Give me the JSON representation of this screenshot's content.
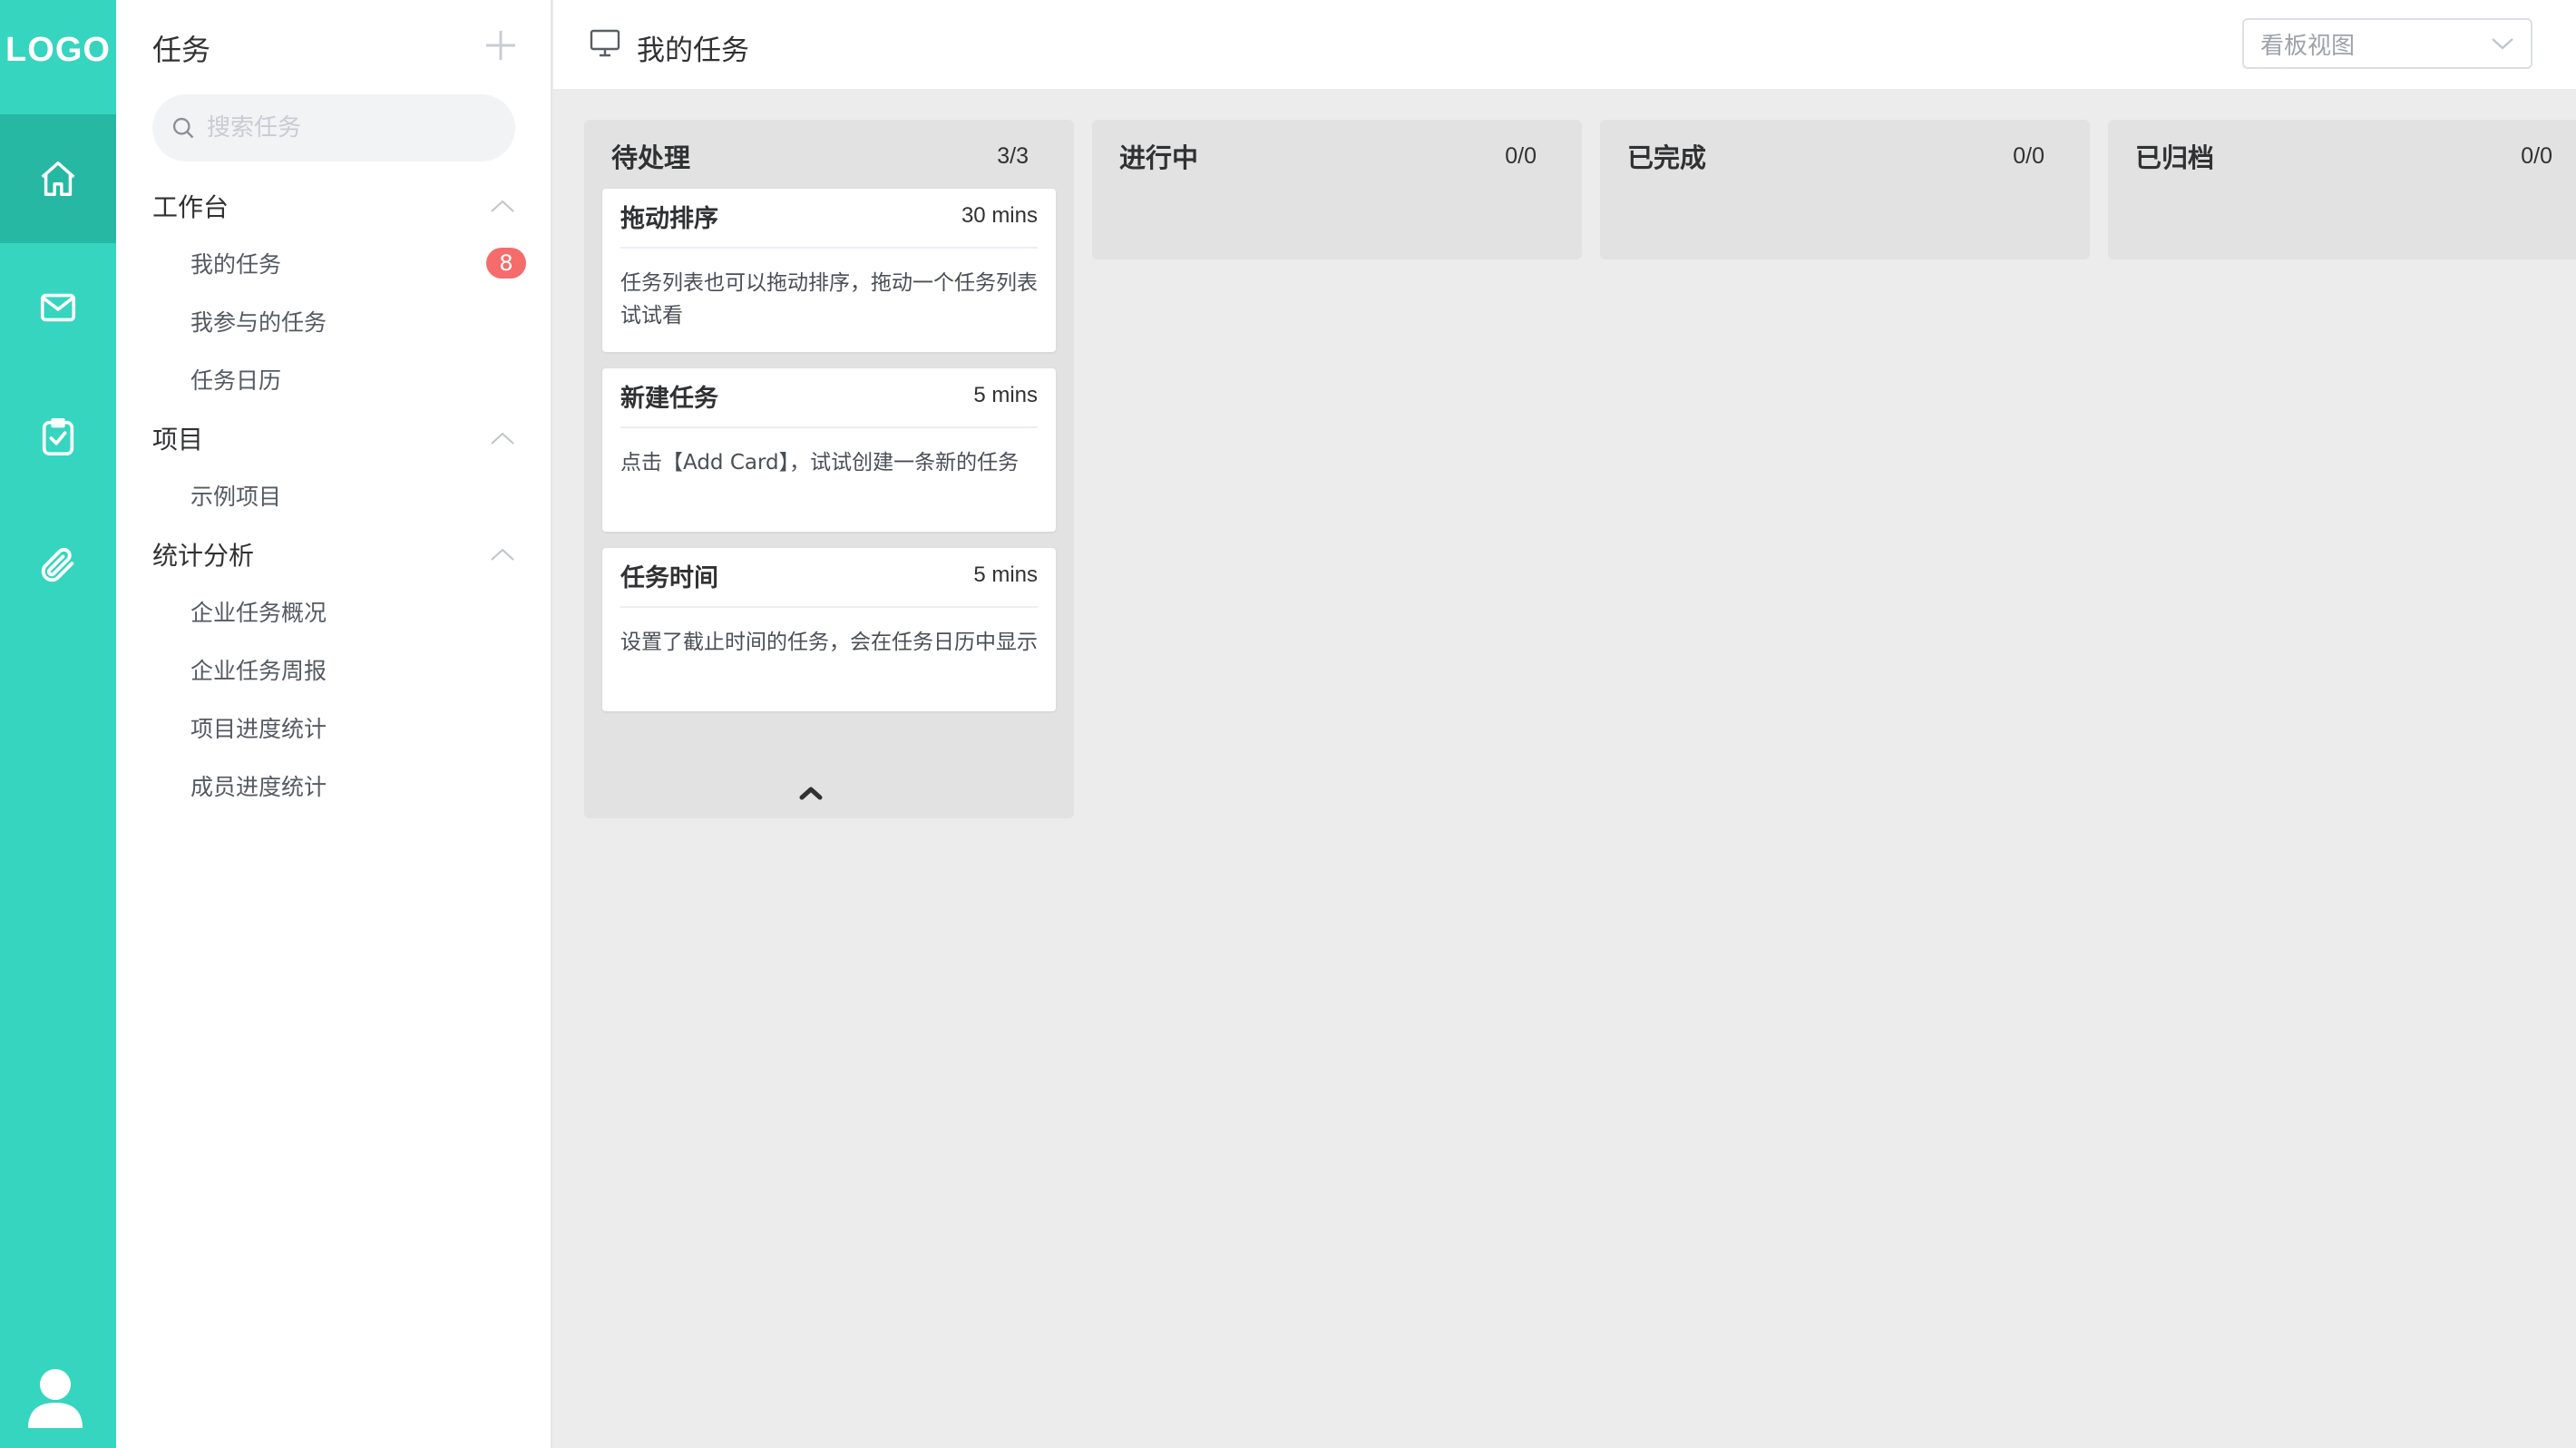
{
  "rail": {
    "logo": "LOGO",
    "items": [
      {
        "name": "home-icon",
        "active": true
      },
      {
        "name": "mail-icon",
        "active": false
      },
      {
        "name": "clipboard-check-icon",
        "active": false
      },
      {
        "name": "paperclip-icon",
        "active": false
      }
    ],
    "avatar": "user-avatar-icon",
    "accent": "#36d5bf",
    "active_bg": "#27b8a3"
  },
  "sidebar": {
    "title": "任务",
    "search_placeholder": "搜索任务",
    "groups": [
      {
        "label": "工作台",
        "items": [
          {
            "label": "我的任务",
            "badge": "8"
          },
          {
            "label": "我参与的任务"
          },
          {
            "label": "任务日历"
          }
        ]
      },
      {
        "label": "项目",
        "items": [
          {
            "label": "示例项目"
          }
        ]
      },
      {
        "label": "统计分析",
        "items": [
          {
            "label": "企业任务概况"
          },
          {
            "label": "企业任务周报"
          },
          {
            "label": "项目进度统计"
          },
          {
            "label": "成员进度统计"
          }
        ]
      }
    ]
  },
  "header": {
    "title": "我的任务",
    "view_select": "看板视图"
  },
  "board": {
    "columns": [
      {
        "name": "待处理",
        "count": "3/3",
        "cards": [
          {
            "title": "拖动排序",
            "time": "30 mins",
            "desc": "任务列表也可以拖动排序，拖动一个任务列表试试看"
          },
          {
            "title": "新建任务",
            "time": "5 mins",
            "desc": "点击【Add Card】，试试创建一条新的任务"
          },
          {
            "title": "任务时间",
            "time": "5 mins",
            "desc": "设置了截止时间的任务，会在任务日历中显示"
          }
        ]
      },
      {
        "name": "进行中",
        "count": "0/0",
        "cards": []
      },
      {
        "name": "已完成",
        "count": "0/0",
        "cards": []
      },
      {
        "name": "已归档",
        "count": "0/0",
        "cards": []
      }
    ]
  }
}
